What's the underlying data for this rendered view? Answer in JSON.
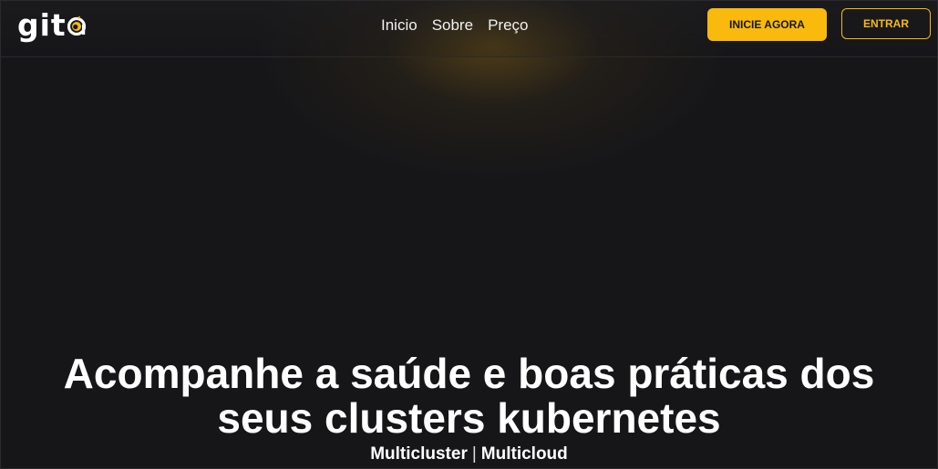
{
  "brand": {
    "name": "gita",
    "logo_text": "git",
    "logo_mark_icon": "a-mark-icon",
    "accent": "#f9b90d",
    "background": "#161619"
  },
  "nav": {
    "items": [
      {
        "label": "Inicio"
      },
      {
        "label": "Sobre"
      },
      {
        "label": "Preço"
      }
    ]
  },
  "actions": {
    "primary_label": "INICIE AGORA",
    "secondary_label": "ENTRAR"
  },
  "hero": {
    "title_line1": "Acompanhe a saúde e boas práticas dos",
    "title_line2": "seus clusters kubernetes",
    "subtitle_left": "Multicluster",
    "subtitle_sep": "|",
    "subtitle_right": "Multicloud"
  }
}
